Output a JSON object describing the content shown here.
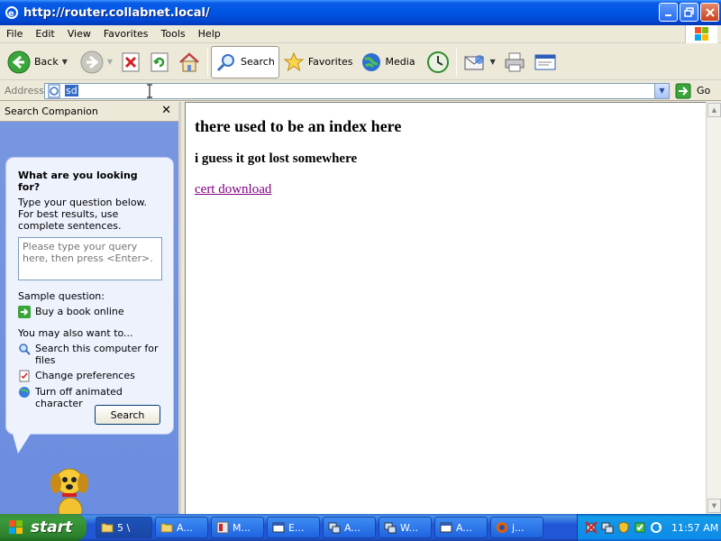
{
  "window": {
    "title": "http://router.collabnet.local/"
  },
  "menu": [
    "File",
    "Edit",
    "View",
    "Favorites",
    "Tools",
    "Help"
  ],
  "toolbar": {
    "back_label": "Back",
    "search_label": "Search",
    "favorites_label": "Favorites",
    "media_label": "Media"
  },
  "address": {
    "label": "Address",
    "value": "sd",
    "go_label": "Go"
  },
  "search_companion": {
    "title": "Search Companion",
    "question_title": "What are you looking for?",
    "question_desc": "Type your question below. For best results, use complete sentences.",
    "input_placeholder": "Please type your query here, then press <Enter>.",
    "sample_label": "Sample question:",
    "sample_link": "Buy a book online",
    "also_label": "You may also want to...",
    "links": [
      "Search this computer for files",
      "Change preferences",
      "Turn off animated character"
    ],
    "search_button": "Search"
  },
  "page": {
    "heading": "there used to be an index here",
    "subheading": "i guess it got lost somewhere",
    "link": "cert download"
  },
  "taskbar": {
    "start_label": "start",
    "tasks": [
      "5 \\",
      "A...",
      "M...",
      "E...",
      "A...",
      "W...",
      "A...",
      "j..."
    ],
    "clock": "11:57 AM"
  },
  "colors": {
    "titlebar": "#0055e5",
    "link_visited": "#800080",
    "taskbar": "#2157d7",
    "start_green": "#3a9a3a"
  }
}
